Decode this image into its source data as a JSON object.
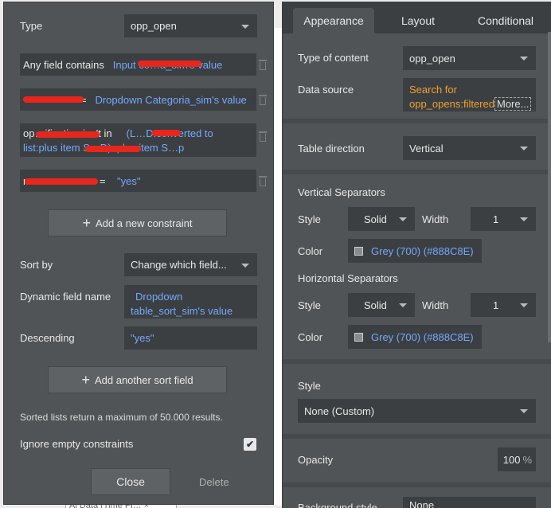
{
  "left_panel": {
    "type_label": "Type",
    "type_value": "opp_open",
    "constraints": [
      {
        "prefix": "Any field contains",
        "value": "Input co…a_sim's value"
      },
      {
        "prefix": "",
        "eq": "=",
        "value": "Dropdown Categoria_sim's value"
      },
      {
        "prefix": "op…ification isn't in",
        "value_line1": "(L…D:converted to",
        "value_line2": "list:plus item S…D) :plus item S…p"
      },
      {
        "prefix": "m…",
        "eq": "=",
        "value": "\"yes\""
      }
    ],
    "add_constraint_label": "Add a new constraint",
    "sort_by_label": "Sort by",
    "sort_by_value": "Change which field...",
    "dynamic_field_label": "Dynamic field name",
    "dynamic_field_line1": "Dropdown",
    "dynamic_field_line2": "table_sort_sim's value",
    "descending_label": "Descending",
    "descending_value": "\"yes\"",
    "add_sort_label": "Add another sort field",
    "sorted_note": "Sorted lists return a maximum of 50.000 results.",
    "ignore_empty_label": "Ignore empty constraints",
    "ignore_empty_checked": "✔",
    "close_label": "Close",
    "delete_label": "Delete"
  },
  "right_panel": {
    "tabs": [
      {
        "label": "Appearance"
      },
      {
        "label": "Layout"
      },
      {
        "label": "Conditional"
      }
    ],
    "type_of_content_label": "Type of content",
    "type_of_content_value": "opp_open",
    "data_source_label": "Data source",
    "data_source_line1": "Search for",
    "data_source_line2": "opp_opens:filtered",
    "data_source_more": "More...",
    "table_direction_label": "Table direction",
    "table_direction_value": "Vertical",
    "vertical_separators_label": "Vertical Separators",
    "v_style_label": "Style",
    "v_style_value": "Solid",
    "v_width_label": "Width",
    "v_width_value": "1",
    "v_color_label": "Color",
    "v_color_value": "Grey (700) (#888C8E)",
    "horizontal_separators_label": "Horizontal Separators",
    "h_style_label": "Style",
    "h_style_value": "Solid",
    "h_width_label": "Width",
    "h_width_value": "1",
    "h_color_label": "Color",
    "h_color_value": "Grey (700) (#888C8E)",
    "style_label": "Style",
    "style_value": "None (Custom)",
    "opacity_label": "Opacity",
    "opacity_value": "100",
    "opacity_unit": "%",
    "background_style_label": "Background style",
    "background_style_value": "None"
  },
  "background": {
    "bottom_field_text": "Ai Data (Time Pi… ×"
  },
  "colors": {
    "panel": "#515456",
    "field": "#3c3f41",
    "dynamic_blue": "#74a8ff",
    "dynamic_orange": "#f0a030",
    "grey_700": "#888C8E"
  }
}
